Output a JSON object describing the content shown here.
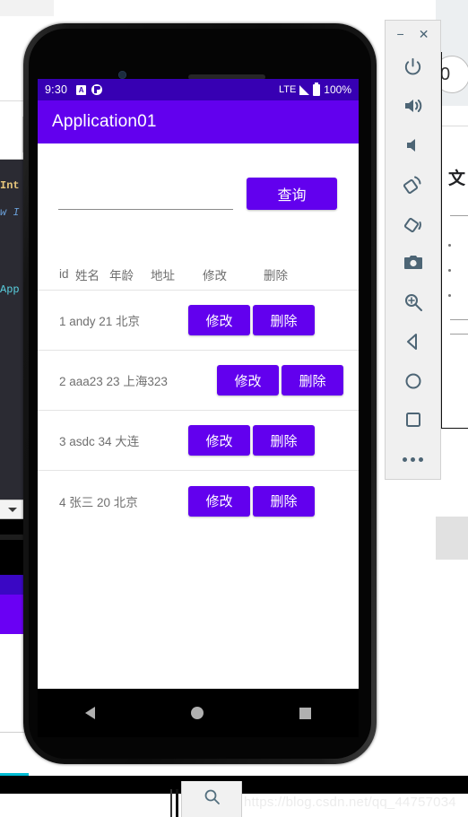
{
  "background": {
    "ide_lines": [
      "Int",
      "w I",
      "App"
    ],
    "browser": {
      "pill_text": "0",
      "cn_char": "文"
    },
    "watermark": "https://blog.csdn.net/qq_44757034"
  },
  "phone": {
    "statusbar": {
      "time": "9:30",
      "icon_a": "A",
      "icon_notification": "clock-icon",
      "network": "LTE",
      "signal_icon": "signal-icon",
      "battery_icon": "battery-icon",
      "battery_text": "100%"
    },
    "appbar": {
      "title": "Application01"
    },
    "search": {
      "value": "",
      "placeholder": "",
      "button_label": "查询"
    },
    "table": {
      "headers": [
        "id",
        "姓名",
        "年龄",
        "地址",
        "修改",
        "删除"
      ],
      "rows": [
        {
          "id": "1",
          "name": "andy",
          "age": "21",
          "address": "北京",
          "text": "1 andy 21 北京",
          "edit": "修改",
          "delete": "删除",
          "wide": false,
          "annotated": false
        },
        {
          "id": "2",
          "name": "aaa23",
          "age": "23",
          "address": "上海323",
          "text": "2 aaa23 23 上海323",
          "edit": "修改",
          "delete": "删除",
          "wide": true,
          "annotated": true
        },
        {
          "id": "3",
          "name": "asdc",
          "age": "34",
          "address": "大连",
          "text": "3 asdc 34 大连",
          "edit": "修改",
          "delete": "删除",
          "wide": false,
          "annotated": false
        },
        {
          "id": "4",
          "name": "张三",
          "age": "20",
          "address": "北京",
          "text": "4 张三 20 北京",
          "edit": "修改",
          "delete": "删除",
          "wide": false,
          "annotated": false
        }
      ]
    },
    "navbar": {
      "back": "back-icon",
      "home": "home-icon",
      "recent": "recent-apps-icon"
    }
  },
  "emulator_toolbar": {
    "minimize": "−",
    "close": "✕",
    "buttons": [
      {
        "name": "power-icon"
      },
      {
        "name": "volume-up-icon"
      },
      {
        "name": "volume-down-icon"
      },
      {
        "name": "rotate-left-icon"
      },
      {
        "name": "rotate-right-icon"
      },
      {
        "name": "camera-icon"
      },
      {
        "name": "zoom-icon"
      },
      {
        "name": "back-icon"
      },
      {
        "name": "home-icon"
      },
      {
        "name": "overview-icon"
      },
      {
        "name": "more-icon"
      }
    ]
  },
  "colors": {
    "primary": "#6200ee",
    "primary_dark": "#3700b3",
    "annotation_red": "#e8000d",
    "toolbar_icon": "#4d6575"
  }
}
